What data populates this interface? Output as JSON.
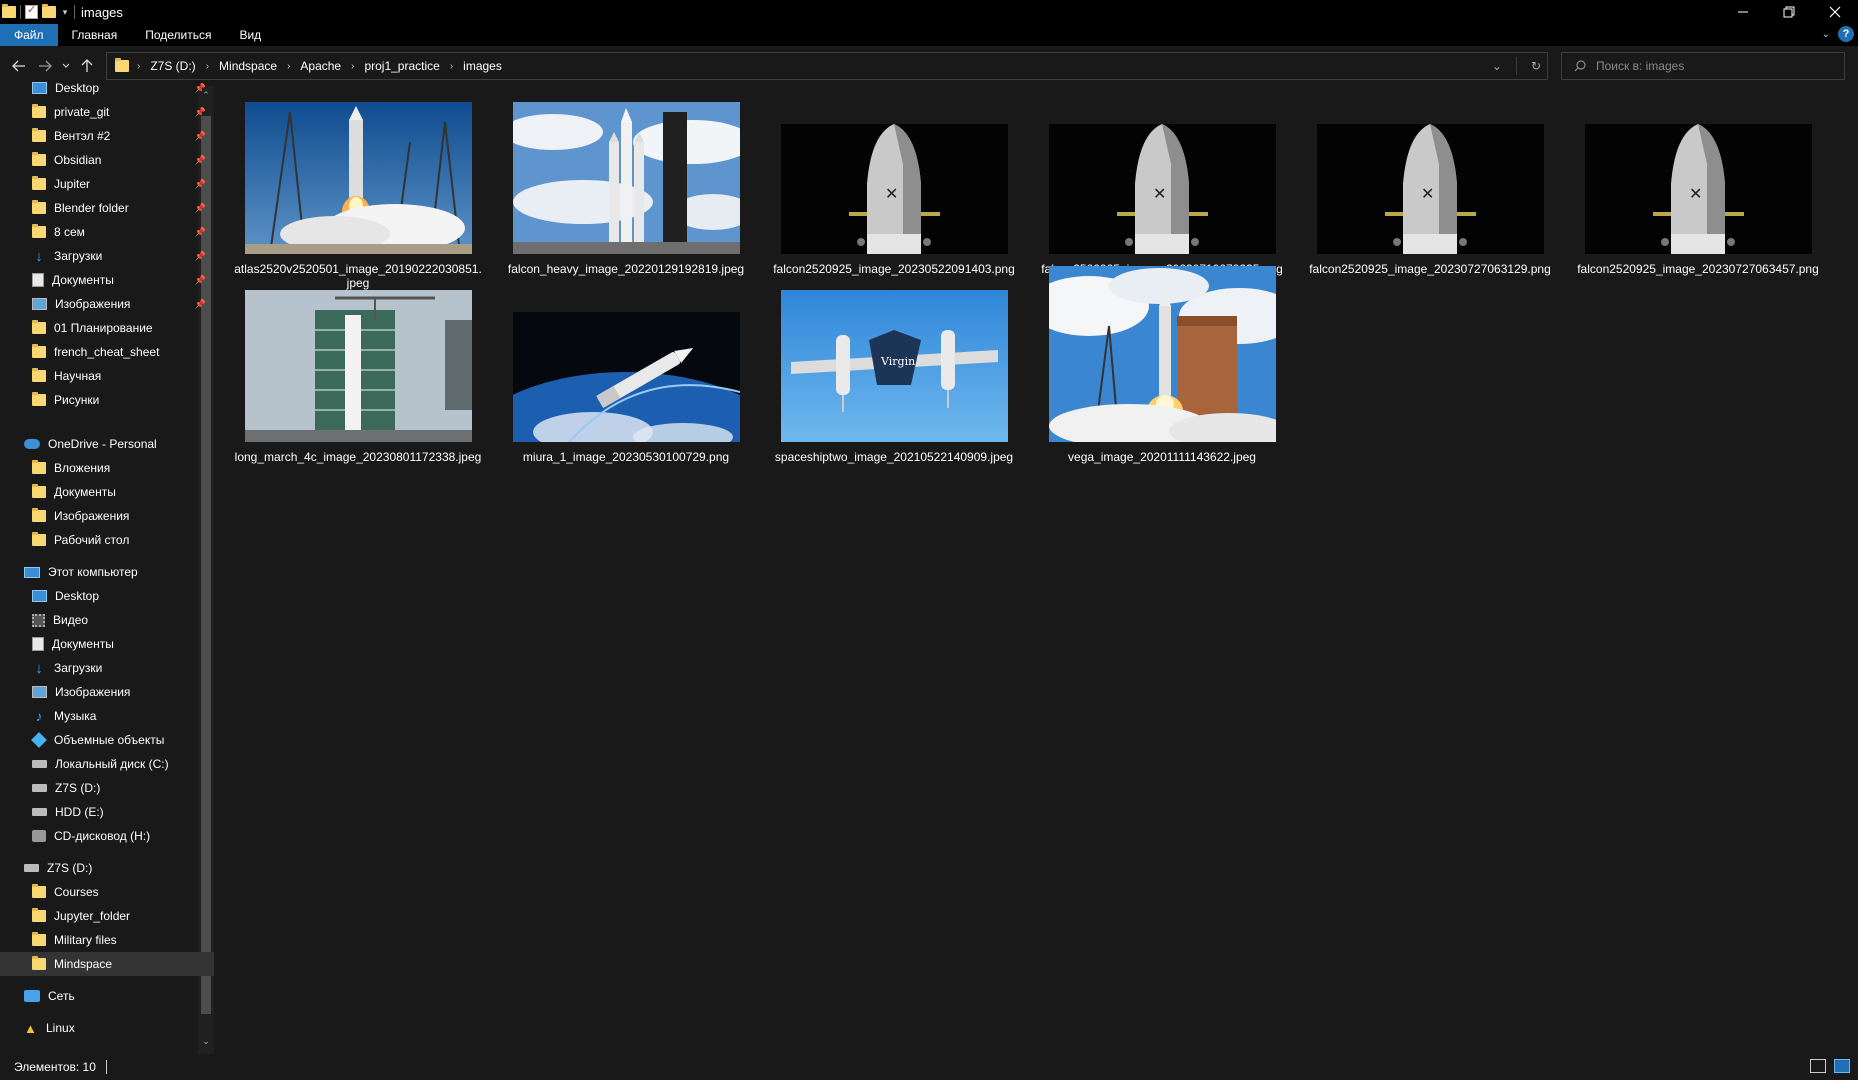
{
  "window": {
    "title": "images"
  },
  "ribbon": {
    "tabs": [
      "Файл",
      "Главная",
      "Поделиться",
      "Вид"
    ],
    "active_tab": "Файл"
  },
  "address": {
    "crumbs": [
      "Z7S (D:)",
      "Mindspace",
      "Apache",
      "proj1_practice",
      "images"
    ]
  },
  "search": {
    "placeholder": "Поиск в: images"
  },
  "sidebar": {
    "quick_access": [
      {
        "label": "Desktop",
        "icon": "desktop-icon",
        "pinned": true
      },
      {
        "label": "private_git",
        "icon": "folder-icon",
        "pinned": true
      },
      {
        "label": "Вентэл #2",
        "icon": "folder-icon",
        "pinned": true
      },
      {
        "label": "Obsidian",
        "icon": "folder-icon",
        "pinned": true
      },
      {
        "label": "Jupiter",
        "icon": "folder-icon",
        "pinned": true
      },
      {
        "label": "Blender folder",
        "icon": "folder-icon",
        "pinned": true
      },
      {
        "label": "8 сем",
        "icon": "folder-icon",
        "pinned": true
      },
      {
        "label": "Загрузки",
        "icon": "download-icon",
        "pinned": true
      },
      {
        "label": "Документы",
        "icon": "documents-icon",
        "pinned": true
      },
      {
        "label": "Изображения",
        "icon": "pictures-icon",
        "pinned": true
      },
      {
        "label": "01 Планирование",
        "icon": "folder-icon",
        "pinned": false
      },
      {
        "label": "french_cheat_sheet",
        "icon": "folder-icon",
        "pinned": false
      },
      {
        "label": "Научная",
        "icon": "folder-icon",
        "pinned": false
      },
      {
        "label": "Рисунки",
        "icon": "folder-icon",
        "pinned": false
      }
    ],
    "onedrive": {
      "label": "OneDrive - Personal",
      "items": [
        "Вложения",
        "Документы",
        "Изображения",
        "Рабочий стол"
      ]
    },
    "this_pc": {
      "label": "Этот компьютер",
      "items": [
        {
          "label": "Desktop",
          "icon": "desktop-icon"
        },
        {
          "label": "Видео",
          "icon": "video-icon"
        },
        {
          "label": "Документы",
          "icon": "documents-icon"
        },
        {
          "label": "Загрузки",
          "icon": "download-icon"
        },
        {
          "label": "Изображения",
          "icon": "pictures-icon"
        },
        {
          "label": "Музыка",
          "icon": "music-icon"
        },
        {
          "label": "Объемные объекты",
          "icon": "3d-objects-icon"
        },
        {
          "label": "Локальный диск (C:)",
          "icon": "drive-icon"
        },
        {
          "label": "Z7S (D:)",
          "icon": "drive-icon"
        },
        {
          "label": "HDD (E:)",
          "icon": "drive-icon"
        },
        {
          "label": "CD-дисковод (H:)",
          "icon": "cd-drive-icon"
        }
      ]
    },
    "drive_d": {
      "label": "Z7S (D:)",
      "items": [
        "Courses",
        "Jupyter_folder",
        "Military files",
        "Mindspace"
      ],
      "selected": "Mindspace"
    },
    "network": {
      "label": "Сеть"
    },
    "linux": {
      "label": "Linux"
    }
  },
  "files": [
    {
      "name": "atlas2520v2520501_image_20190222030851.jpeg",
      "kind": "atlas-launch"
    },
    {
      "name": "falcon_heavy_image_20220129192819.jpeg",
      "kind": "falcon-heavy"
    },
    {
      "name": "falcon2520925_image_20230522091403.png",
      "kind": "falcon-fairing"
    },
    {
      "name": "falcon2520925_image_20230710073235.png",
      "kind": "falcon-fairing"
    },
    {
      "name": "falcon2520925_image_20230727063129.png",
      "kind": "falcon-fairing"
    },
    {
      "name": "falcon2520925_image_20230727063457.png",
      "kind": "falcon-fairing"
    },
    {
      "name": "long_march_4c_image_20230801172338.jpeg",
      "kind": "long-march"
    },
    {
      "name": "miura_1_image_20230530100729.png",
      "kind": "miura"
    },
    {
      "name": "spaceshiptwo_image_20210522140909.jpeg",
      "kind": "spaceshiptwo"
    },
    {
      "name": "vega_image_20201111143622.jpeg",
      "kind": "vega"
    }
  ],
  "status": {
    "item_count": "Элементов: 10"
  },
  "colors": {
    "accent": "#1f6fb5",
    "background": "#191919",
    "folder": "#f8d775"
  }
}
